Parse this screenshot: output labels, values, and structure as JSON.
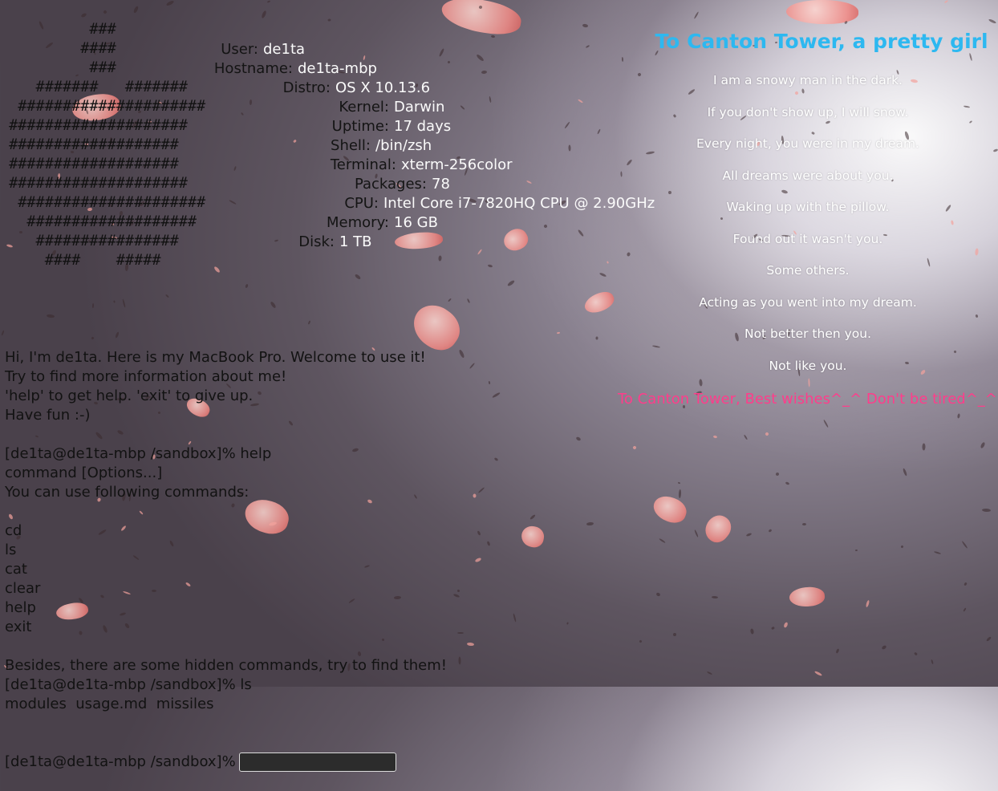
{
  "logo_ascii": "          ###\n         ####\n          ###\n    #######   #######\n  #####################\n ####################\n ###################\n ###################\n ####################\n  #####################\n   ###################\n    ################\n     ####    #####",
  "sysinfo": [
    {
      "key": "User:",
      "value": "de1ta"
    },
    {
      "key": "Hostname:",
      "value": "de1ta-mbp"
    },
    {
      "key": "Distro:",
      "value": "OS X 10.13.6"
    },
    {
      "key": "Kernel:",
      "value": "Darwin"
    },
    {
      "key": "Uptime:",
      "value": "17 days"
    },
    {
      "key": "Shell:",
      "value": "/bin/zsh"
    },
    {
      "key": "Terminal:",
      "value": "xterm-256color"
    },
    {
      "key": "Packages:",
      "value": "78"
    },
    {
      "key": "CPU:",
      "value": "Intel Core i7-7820HQ CPU @ 2.90GHz"
    },
    {
      "key": "Memory:",
      "value": "16 GB"
    },
    {
      "key": "Disk:",
      "value": "1 TB"
    }
  ],
  "terminal": {
    "lines": [
      "Hi, I'm de1ta. Here is my MacBook Pro. Welcome to use it!",
      "Try to find more information about me!",
      "'help' to get help. 'exit' to give up.",
      "Have fun :-)",
      "",
      "[de1ta@de1ta-mbp /sandbox]% help",
      "command [Options...]",
      "You can use following commands:",
      "",
      "cd",
      "ls",
      "cat",
      "clear",
      "help",
      "exit",
      "",
      "Besides, there are some hidden commands, try to find them!",
      "[de1ta@de1ta-mbp /sandbox]% ls",
      "modules  usage.md  missiles"
    ],
    "prompt": "[de1ta@de1ta-mbp /sandbox]%",
    "input_value": ""
  },
  "poem": {
    "title": "To Canton Tower, a pretty girl",
    "lines": [
      "I am a snowy man in the dark.",
      "If you don't show up, I will snow.",
      "Every night, you were in my dream.",
      "All dreams were about you.",
      "Waking up with the pillow.",
      "Found out it wasn't you.",
      "Some others.",
      "Acting as you went into my dream.",
      "Not better then you.",
      "Not like you."
    ],
    "wishes": "To Canton Tower, Best wishes^_^  Don't be tired^_^"
  },
  "colors": {
    "poem_title": "#2db8f0",
    "wishes": "#ff3d8b",
    "value_text": "#fafafa",
    "key_text": "#141414"
  }
}
